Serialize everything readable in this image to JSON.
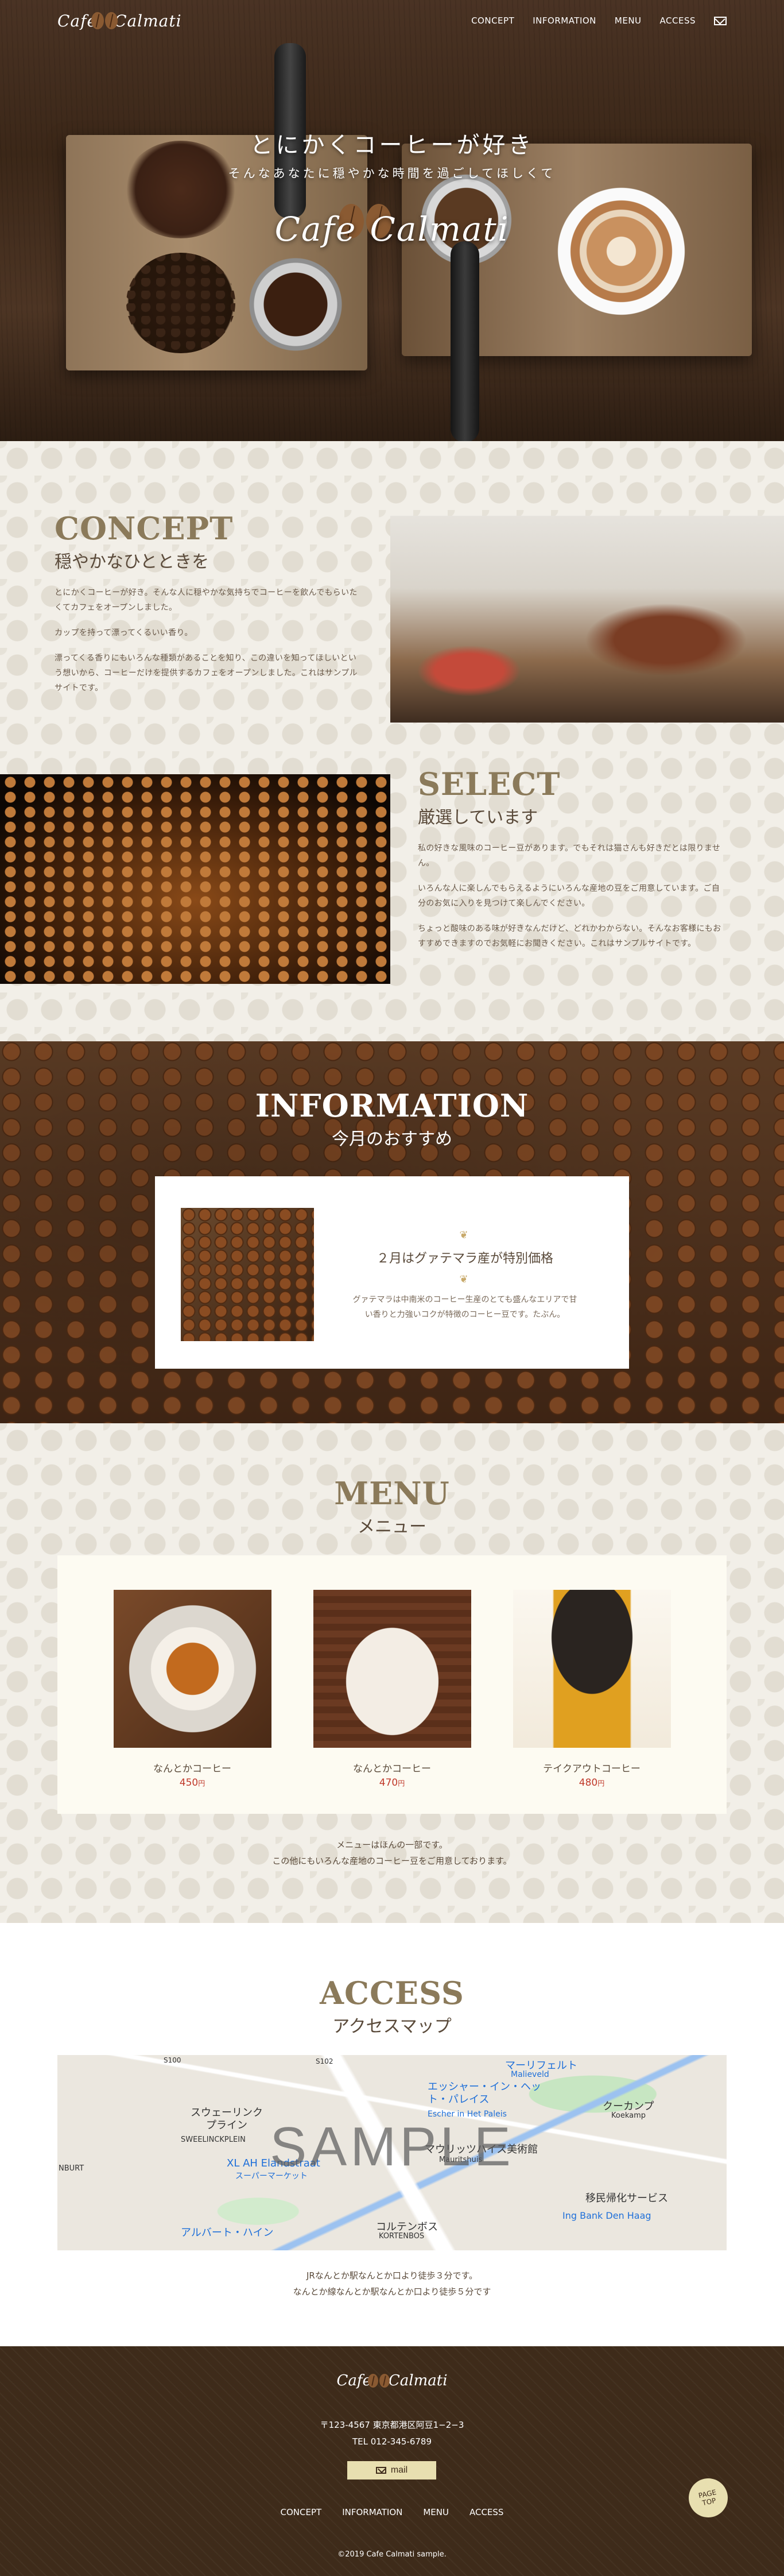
{
  "brand": {
    "logo_prefix": "Cafe",
    "logo_suffix": "Calmati"
  },
  "nav": {
    "items": [
      "CONCEPT",
      "INFORMATION",
      "MENU",
      "ACCESS"
    ],
    "mail_icon": "mail-icon"
  },
  "hero": {
    "title": "とにかくコーヒーが好き",
    "subtitle": "そんなあなたに穏やかな時間を過ごしてほしくて",
    "logo_prefix": "Cafe",
    "logo_suffix": "Calmati"
  },
  "concept": {
    "heading": "CONCEPT",
    "sub": "穏やかなひとときを",
    "paragraphs": [
      "とにかくコーヒーが好き。そんな人に穏やかな気持ちでコーヒーを飲んでもらいたくてカフェをオープンしました。",
      "カップを持って漂ってくるいい香り。",
      "漂ってくる香りにもいろんな種類があることを知り、この違いを知ってほしいという想いから、コーヒーだけを提供するカフェをオープンしました。これはサンプルサイトです。"
    ]
  },
  "select": {
    "heading": "SELECT",
    "sub": "厳選しています",
    "paragraphs": [
      "私の好きな風味のコーヒー豆があります。でもそれは猫さんも好きだとは限りません。",
      "いろんな人に楽しんでもらえるようにいろんな産地の豆をご用意しています。ご自分のお気に入りを見つけて楽しんでください。",
      "ちょっと酸味のある味が好きなんだけど、どれかわからない。そんなお客様にもおすすめできますのでお気軽にお聞きください。これはサンプルサイトです。"
    ]
  },
  "information": {
    "heading": "INFORMATION",
    "sub": "今月のおすすめ",
    "card_title": "２月はグァテマラ産が特別価格",
    "ornament": "❦",
    "card_body": "グァテマラは中南米のコーヒー生産のとても盛んなエリアで甘い香りと力強いコクが特徴のコーヒー豆です。たぶん。"
  },
  "menu": {
    "heading": "MENU",
    "sub": "メニュー",
    "items": [
      {
        "name": "なんとかコーヒー",
        "price": "450",
        "unit": "円"
      },
      {
        "name": "なんとかコーヒー",
        "price": "470",
        "unit": "円"
      },
      {
        "name": "テイクアウトコーヒー",
        "price": "480",
        "unit": "円"
      }
    ],
    "note_line1": "メニューはほんの一部です。",
    "note_line2": "この他にもいろんな産地のコーヒー豆をご用意しております。"
  },
  "access": {
    "heading": "ACCESS",
    "sub": "アクセスマップ",
    "map_watermark": "SAMPLE",
    "map_labels": [
      "マーリフェルト",
      "Malieveld",
      "エッシャー・イン・ヘット・パレイス",
      "Escher in Het Paleis",
      "クーカンプ",
      "Koekamp",
      "スウェーリンクプライン",
      "SWEELINCKPLEIN",
      "XL AH Elandstraat",
      "スーパーマーケット",
      "アルバート・ハイン",
      "コルテンボス",
      "KORTENBOS",
      "移民帰化サービス",
      "Ing Bank Den Haag",
      "マウリッツハイス美術館",
      "Mauritshuis",
      "NBURT",
      "S100",
      "S102"
    ],
    "note_line1": "JRなんとか駅なんとか口より徒歩３分です。",
    "note_line2": "なんとか線なんとか駅なんとか口より徒歩５分です"
  },
  "footer": {
    "logo_prefix": "Cafe",
    "logo_suffix": "Calmati",
    "address": "〒123-4567 東京都港区阿豆1−2−3",
    "tel": "TEL 012-345-6789",
    "mail_label": "mail",
    "nav": [
      "CONCEPT",
      "INFORMATION",
      "MENU",
      "ACCESS"
    ],
    "copyright": "©2019 Cafe Calmati sample.",
    "pagetop_line1": "PAGE",
    "pagetop_line2": "TOP"
  }
}
